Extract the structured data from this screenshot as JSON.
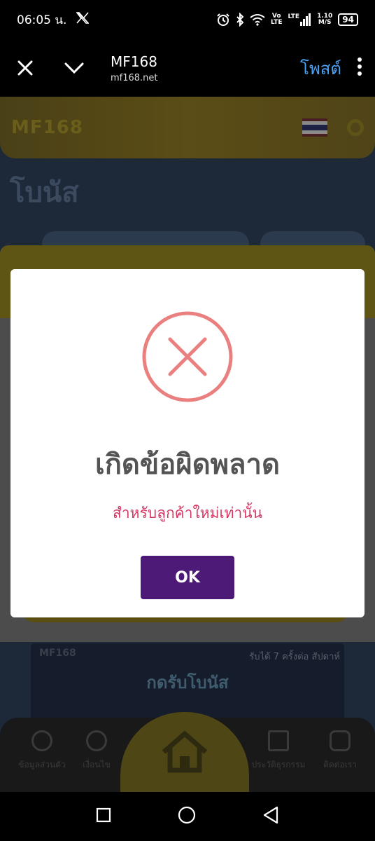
{
  "status_bar": {
    "time": "06:05 น.",
    "x_app_icon": "x-logo-icon",
    "volte_top": "Vo",
    "volte_bottom": "LTE",
    "lte": "LTE",
    "speed_value": "1.10",
    "speed_unit": "M/S",
    "battery": "94"
  },
  "browser": {
    "title": "MF168",
    "url": "mf168.net",
    "post_label": "โพสต์"
  },
  "webpage": {
    "site_logo": "MF168",
    "page_heading": "โบนัส",
    "banner_logo": "MF168",
    "banner_text": "กดรับโบนัส",
    "banner_tag": "รับได้ 7 ครั้งต่อ สัปดาห์",
    "nav": [
      {
        "label": "ข้อมูลส่วนตัว"
      },
      {
        "label": "เงื่อนไข"
      },
      {
        "label": "ประวัติธุรกรรม"
      },
      {
        "label": "ติดต่อเรา"
      }
    ]
  },
  "modal": {
    "title": "เกิดข้อผิดพลาด",
    "message": "สำหรับลูกค้าใหม่เท่านั้น",
    "ok_label": "OK",
    "colors": {
      "error": "#ea7f7f",
      "message": "#d63864",
      "button": "#4e1a78"
    }
  }
}
